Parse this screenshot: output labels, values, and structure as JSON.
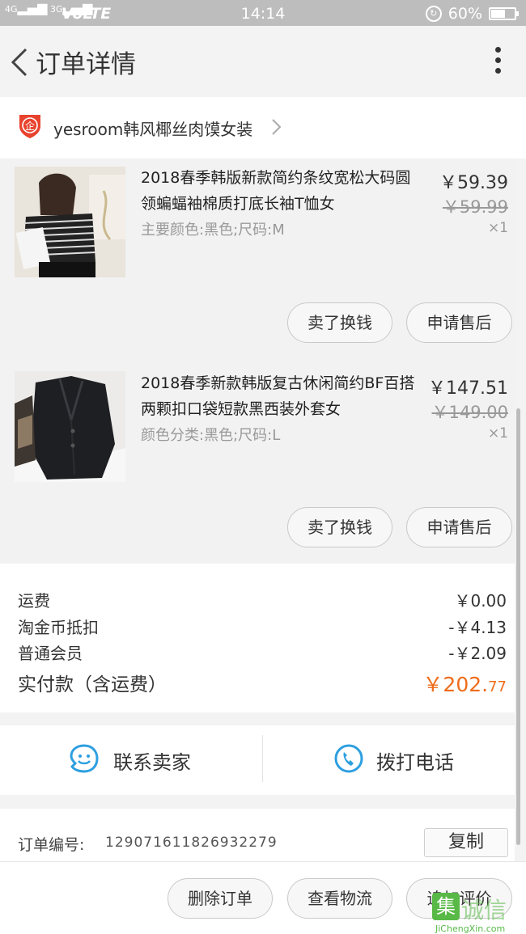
{
  "status_bar": {
    "signal1": "4G",
    "signal2": "3G",
    "network": "VoLTE",
    "time": "14:14",
    "battery_text": "60%",
    "battery_level": 0.6
  },
  "nav": {
    "title": "订单详情"
  },
  "shop": {
    "name": "yesroom韩风椰丝肉馍女装",
    "badge": "企",
    "badge_color": "#e8432e"
  },
  "items": [
    {
      "title": "2018春季韩版新款简约条纹宽松大码圆领蝙蝠袖棉质打底长袖T恤女",
      "sku": "主要颜色:黑色;尺码:M",
      "price": "￥59.39",
      "original_price": "￥59.99",
      "quantity": "×1",
      "buttons": [
        "卖了换钱",
        "申请售后"
      ]
    },
    {
      "title": "2018春季新款韩版复古休闲简约BF百搭两颗扣口袋短款黑西装外套女",
      "sku": "颜色分类:黑色;尺码:L",
      "price": "￥147.51",
      "original_price": "￥149.00",
      "quantity": "×1",
      "buttons": [
        "卖了换钱",
        "申请售后"
      ]
    }
  ],
  "summary": {
    "shipping_label": "运费",
    "shipping_value": "￥0.00",
    "coin_label": "淘金币抵扣",
    "coin_value": "-￥4.13",
    "member_label": "普通会员",
    "member_value": "-￥2.09",
    "total_label": "实付款（含运费）",
    "total_value_main": "￥202.",
    "total_value_cents": "77",
    "total_color": "#ef6c1a"
  },
  "contact": {
    "seller_label": "联系卖家",
    "phone_label": "拨打电话",
    "icon_color": "#2e9fe0"
  },
  "order": {
    "number_label": "订单编号:",
    "number": "129071611826932279",
    "copy_label": "复制"
  },
  "footer": {
    "delete_label": "删除订单",
    "logistics_label": "查看物流",
    "review_label": "追加评价"
  },
  "watermark": {
    "logo": "集",
    "text": "诚信",
    "sub": "JiChengXin.com"
  }
}
